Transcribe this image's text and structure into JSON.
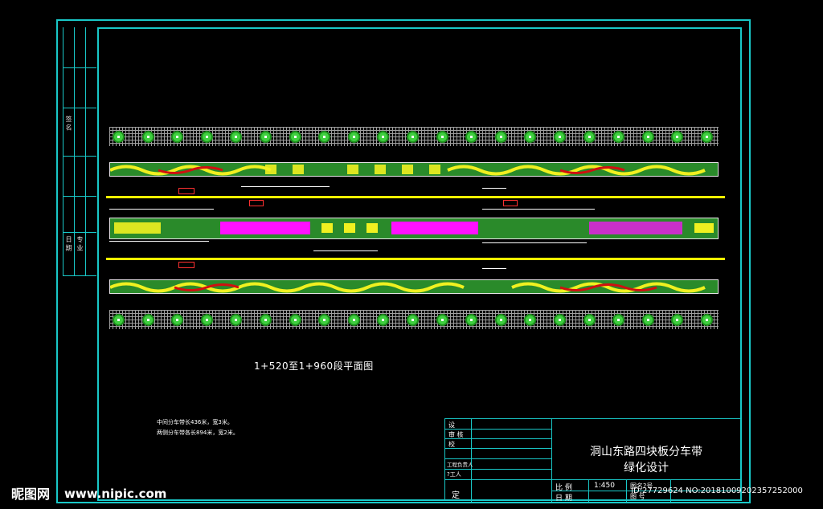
{
  "drawing": {
    "title_line1": "洞山东路四块板分车带",
    "title_line2": "绿化设计",
    "scale_label": "比  例",
    "scale_value": "1:450",
    "date_label": "日  期",
    "section_caption": "1+520至1+960段平面图",
    "note_line1": "中间分车带长436米，宽3米。",
    "note_line2": "两侧分车带各长894米，宽2米。"
  },
  "title_block": {
    "row_labels": [
      "设",
      "审  核",
      "校",
      "工程负责人",
      "?工人"
    ],
    "bottom_label": "定",
    "right_labels": [
      "图名?号",
      "图  号"
    ]
  },
  "side_column": {
    "labels": [
      "签  名",
      "日  期",
      "专  业"
    ]
  },
  "watermark": {
    "logo": "昵图网",
    "url": "www.nipic.com",
    "id_text": "ID:27729624 NO:20181009202357252000"
  },
  "colors": {
    "frame": "#19c8c8",
    "lane": "#f0f000",
    "shrub": "#3fcf3f",
    "hedge": "#f0f020",
    "flower": "#ff10ff",
    "red_tag": "#ff3030"
  }
}
